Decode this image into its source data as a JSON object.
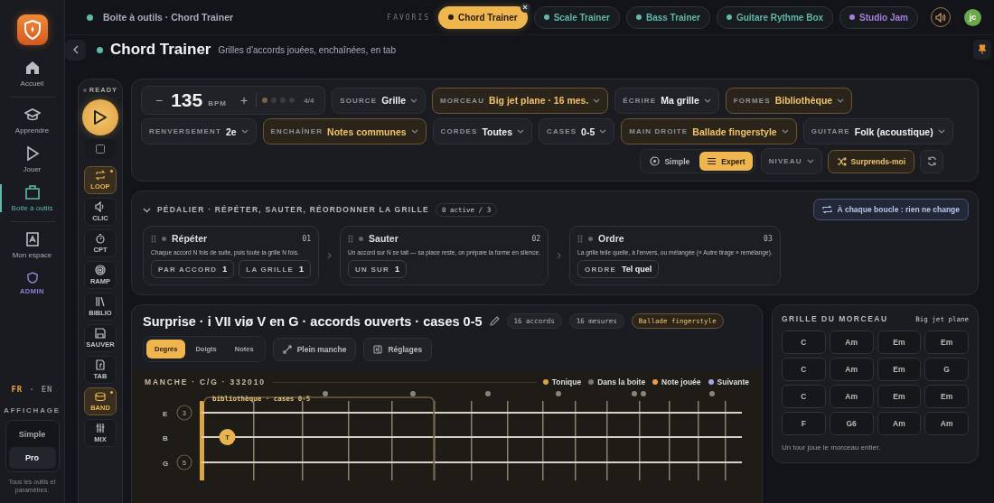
{
  "sidebar": {
    "items": [
      {
        "label": "Accueil",
        "kind": "nav",
        "selected": false
      },
      {
        "label": "Apprendre",
        "kind": "nav",
        "selected": false
      },
      {
        "label": "Jouer",
        "kind": "nav",
        "selected": false
      },
      {
        "label": "Boite à outils",
        "kind": "nav",
        "selected": true
      },
      {
        "label": "Mon espace",
        "kind": "nav",
        "selected": false
      },
      {
        "label": "ADMIN",
        "kind": "admin",
        "selected": false
      }
    ],
    "languages": [
      {
        "label": "FR",
        "selected": true
      },
      {
        "label": "EN",
        "selected": false
      }
    ],
    "language_separator": "·",
    "display": {
      "title": "AFFICHAGE",
      "options": [
        {
          "label": "Simple",
          "selected": false
        },
        {
          "label": "Pro",
          "selected": true
        }
      ],
      "note": "Tous les outils et paramètres."
    }
  },
  "topbar": {
    "breadcrumb": "Boite à outils · Chord Trainer",
    "favorites_label": "FAVORIS",
    "favorites": [
      {
        "label": "Chord Trainer",
        "selected": true,
        "color": "#2a2010"
      },
      {
        "label": "Scale Trainer",
        "selected": false,
        "color": "#5fb8a8"
      },
      {
        "label": "Bass Trainer",
        "selected": false,
        "color": "#5fb8a8"
      },
      {
        "label": "Guitare Rythme Box",
        "selected": false,
        "color": "#5fb8a8"
      },
      {
        "label": "Studio Jam",
        "selected": false,
        "color": "#a77ee0"
      }
    ],
    "avatar": "jc"
  },
  "header": {
    "title": "Chord Trainer",
    "subtitle": "Grilles d'accords jouées, enchaînées, en tab"
  },
  "transport": {
    "status": "READY",
    "decrease": "−",
    "increase": "+",
    "bpm": "135",
    "bpm_unit": "BPM",
    "beats": [
      {
        "on": true
      },
      {
        "on": false
      },
      {
        "on": false
      },
      {
        "on": false
      }
    ],
    "meter": "4/4"
  },
  "tools": [
    {
      "label": "LOOP",
      "on": true
    },
    {
      "label": "CLIC",
      "on": false
    },
    {
      "label": "CPT",
      "on": false
    },
    {
      "label": "RAMP",
      "on": false
    },
    {
      "label": "BIBLIO",
      "on": false
    },
    {
      "label": "SAUVER",
      "on": false
    },
    {
      "label": "TAB",
      "on": false
    },
    {
      "label": "BAND",
      "on": true
    },
    {
      "label": "MIX",
      "on": false
    }
  ],
  "settings": {
    "groups": [
      {
        "dropdowns": [
          {
            "label": "SOURCE",
            "value": "Grille",
            "highlighted": false
          },
          {
            "label": "MORCEAU",
            "value": "Big jet plane · 16 mes.",
            "highlighted": true
          },
          {
            "label": "ÉCRIRE",
            "value": "Ma grille",
            "highlighted": false
          },
          {
            "label": "FORMES",
            "value": "Bibliothèque",
            "highlighted": true
          }
        ]
      },
      {
        "dropdowns": [
          {
            "label": "RENVERSEMENT",
            "value": "2e",
            "highlighted": false
          },
          {
            "label": "ENCHAÎNER",
            "value": "Notes communes",
            "highlighted": true
          },
          {
            "label": "CORDES",
            "value": "Toutes",
            "highlighted": false
          },
          {
            "label": "CASES",
            "value": "0-5",
            "highlighted": false
          },
          {
            "label": "MAIN DROITE",
            "value": "Ballade fingerstyle",
            "highlighted": true
          },
          {
            "label": "GUITARE",
            "value": "Folk (acoustique)",
            "highlighted": false
          }
        ]
      }
    ],
    "modes": [
      {
        "label": "Simple",
        "selected": false
      },
      {
        "label": "Expert",
        "selected": true
      }
    ],
    "level_label": "NIVEAU",
    "surprise": "Surprends-moi"
  },
  "pedalier": {
    "title": "PÉDALIER · RÉPÉTER, SAUTER, RÉORDONNER LA GRILLE",
    "expanded": true,
    "count": "0 active / 3",
    "loop_button": "À chaque boucle : rien ne change",
    "pedals": [
      {
        "name": "Répéter",
        "number": "01",
        "active": false,
        "description": "Chaque accord N fois de suite, puis toute la grille N fois.",
        "params": [
          {
            "label": "PAR ACCORD",
            "value": "1"
          },
          {
            "label": "LA GRILLE",
            "value": "1"
          }
        ]
      },
      {
        "name": "Sauter",
        "number": "02",
        "active": false,
        "description": "Un accord sur N se tait — sa place reste, on prépare la forme en silence.",
        "params": [
          {
            "label": "UN SUR",
            "value": "1"
          }
        ]
      },
      {
        "name": "Ordre",
        "number": "03",
        "active": false,
        "description": "La grille telle quelle, à l'envers, ou mélangée (« Autre tirage » remélange).",
        "params": [
          {
            "label": "ORDRE",
            "value": "Tel quel"
          }
        ]
      }
    ]
  },
  "progression": {
    "title": "Surprise · i VII viø V en G · accords ouverts · cases 0-5",
    "tags": [
      {
        "label": "16 accords",
        "highlighted": false
      },
      {
        "label": "16 mesures",
        "highlighted": false
      },
      {
        "label": "Ballade fingerstyle",
        "highlighted": true
      }
    ],
    "label_modes": [
      {
        "label": "Degrés",
        "selected": true
      },
      {
        "label": "Doigts",
        "selected": false
      },
      {
        "label": "Notes",
        "selected": false
      }
    ],
    "actions": [
      "Plein manche",
      "Réglages"
    ],
    "fretboard": {
      "title": "MANCHE · C/G · 332010",
      "legend": [
        {
          "label": "Tonique",
          "color": "#d9a545"
        },
        {
          "label": "Dans la boite",
          "color": "#7a7670"
        },
        {
          "label": "Note jouée",
          "color": "#e9a04a"
        },
        {
          "label": "Suivante",
          "color": "#a9a6e8"
        }
      ],
      "box_label": "bibliothèque · cases 0-5",
      "strings": [
        {
          "name": "E",
          "finger": "3"
        },
        {
          "name": "B",
          "frets": [
            {
              "kind": "empty"
            },
            {
              "label": "T",
              "kind": "tonic"
            }
          ]
        },
        {
          "name": "G",
          "finger": "5"
        }
      ]
    }
  },
  "song_grid": {
    "title": "GRILLE DU MORCEAU",
    "song": "Big jet plane",
    "chords": [
      [
        "C",
        "Am",
        "Em",
        "Em"
      ],
      [
        "C",
        "Am",
        "Em",
        "G"
      ],
      [
        "C",
        "Am",
        "Em",
        "Em"
      ],
      [
        "F",
        "G6",
        "Am",
        "Am"
      ]
    ],
    "note": "Un tour joue le morceau entier."
  }
}
